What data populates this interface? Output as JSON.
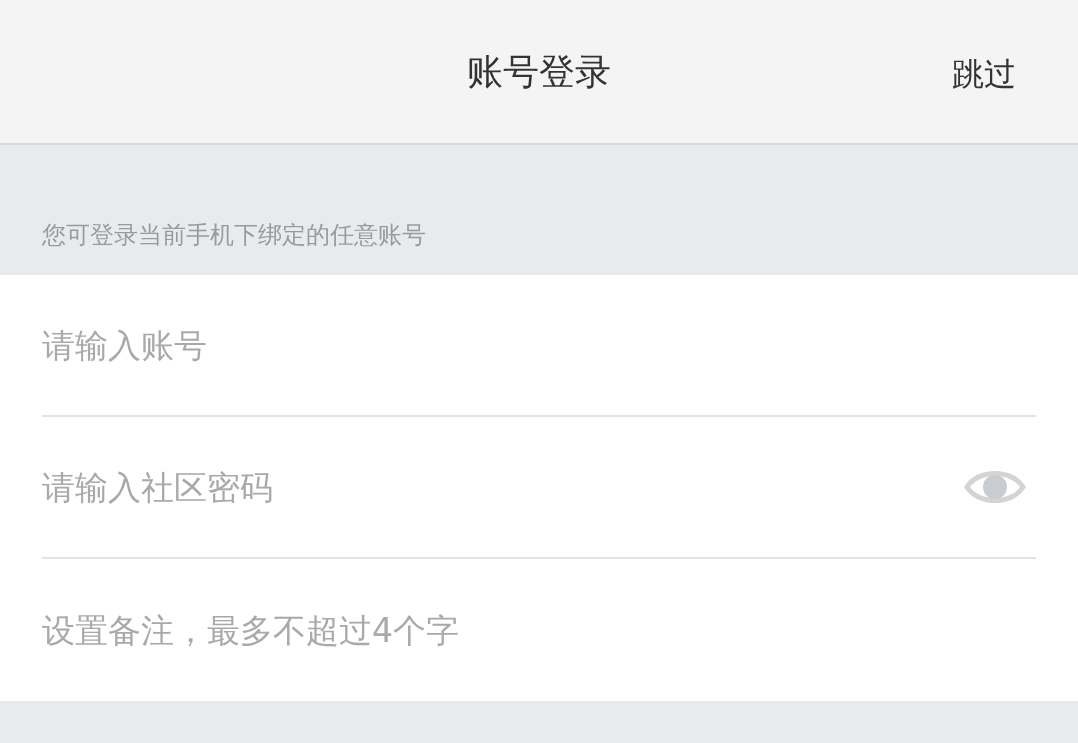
{
  "header": {
    "title": "账号登录",
    "skip": "跳过"
  },
  "hint": "您可登录当前手机下绑定的任意账号",
  "fields": [
    {
      "kind": "text",
      "placeholder": "请输入账号"
    },
    {
      "kind": "password",
      "placeholder": "请输入社区密码"
    },
    {
      "kind": "text",
      "placeholder": "设置备注，最多不超过4个字"
    }
  ]
}
